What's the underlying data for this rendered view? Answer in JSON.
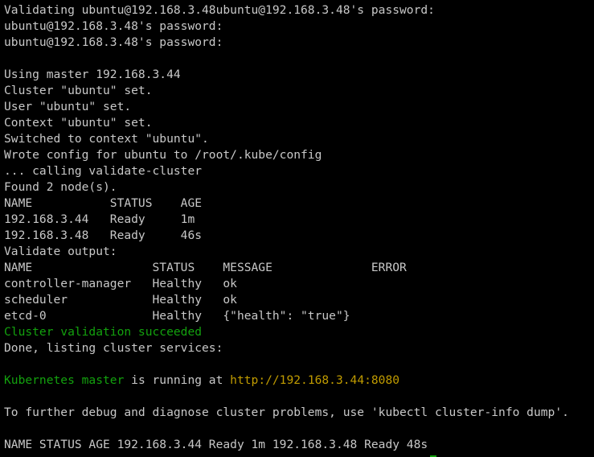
{
  "terminal": {
    "lines": [
      "Validating ubuntu@192.168.3.48ubuntu@192.168.3.48's password:",
      "ubuntu@192.168.3.48's password:",
      "ubuntu@192.168.3.48's password:",
      "",
      "Using master 192.168.3.44",
      "Cluster \"ubuntu\" set.",
      "User \"ubuntu\" set.",
      "Context \"ubuntu\" set.",
      "Switched to context \"ubuntu\".",
      "Wrote config for ubuntu to /root/.kube/config",
      "... calling validate-cluster",
      "Found 2 node(s).",
      "NAME           STATUS    AGE",
      "192.168.3.44   Ready     1m",
      "192.168.3.48   Ready     46s",
      "Validate output:",
      "NAME                 STATUS    MESSAGE              ERROR",
      "controller-manager   Healthy   ok",
      "scheduler            Healthy   ok",
      "etcd-0               Healthy   {\"health\": \"true\"}"
    ],
    "validation_success": "Cluster validation succeeded",
    "done_line": "Done, listing cluster services:",
    "master_label": "Kubernetes master",
    "master_middle": " is running at ",
    "master_url": "http://192.168.3.44:8080",
    "debug_line": "To further debug and diagnose cluster problems, use 'kubectl cluster-info dump'.",
    "nodes_line": "NAME STATUS AGE 192.168.3.44 Ready 1m 192.168.3.48 Ready 48s"
  },
  "colors": {
    "background": "#000000",
    "text": "#c8c8c8",
    "success": "#13a10e",
    "link": "#c19c00",
    "cursor": "#13a10e"
  }
}
